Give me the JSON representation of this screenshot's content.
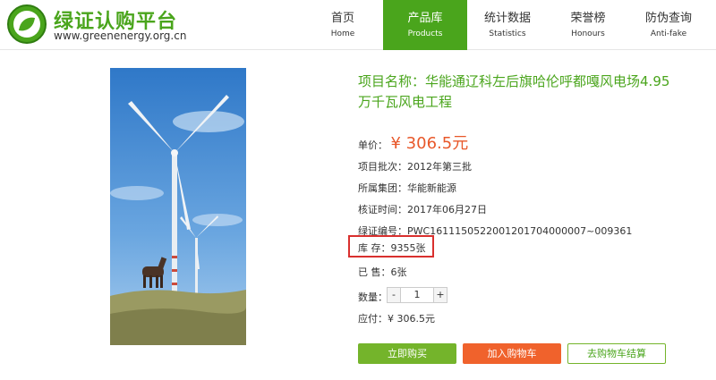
{
  "brand": {
    "name": "绿证认购平台",
    "url": "www.greenenergy.org.cn"
  },
  "nav": [
    {
      "cn": "首页",
      "en": "Home"
    },
    {
      "cn": "产品库",
      "en": "Products"
    },
    {
      "cn": "统计数据",
      "en": "Statistics"
    },
    {
      "cn": "荣誉榜",
      "en": "Honours"
    },
    {
      "cn": "防伪查询",
      "en": "Anti-fake"
    }
  ],
  "product": {
    "title": "项目名称：华能通辽科左后旗哈伦呼都嘎风电场4.95万千瓦风电工程",
    "price_label": "单价：",
    "price_value": "¥ 306.5元",
    "batch": "项目批次：2012年第三批",
    "group": "所属集团：华能新能源",
    "date": "核证时间：2017年06月27日",
    "code": "绿证编号：PWC1611150522001201704000007~009361",
    "stock": "库 存：9355张",
    "sold": "已 售：6张",
    "qty_label": "数量：",
    "qty_minus": "-",
    "qty_value": "1",
    "qty_plus": "+",
    "total": "应付：¥ 306.5元"
  },
  "buttons": {
    "buy": "立即购买",
    "cart": "加入购物车",
    "checkout": "去购物车结算"
  },
  "colors": {
    "brand_green": "#4aa51c",
    "price_orange": "#e8582a",
    "highlight_red": "#d9302e"
  }
}
